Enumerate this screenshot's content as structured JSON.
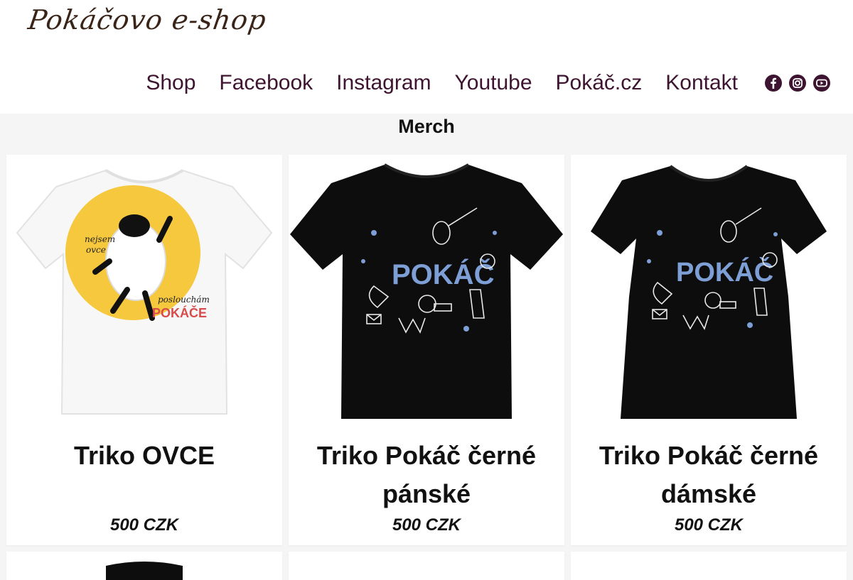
{
  "header": {
    "logo_text": "Pokáčovo e-shop",
    "nav": [
      {
        "label": "Shop"
      },
      {
        "label": "Facebook"
      },
      {
        "label": "Instagram"
      },
      {
        "label": "Youtube"
      },
      {
        "label": "Pokáč.cz"
      },
      {
        "label": "Kontakt"
      }
    ],
    "social_icons": [
      "facebook-icon",
      "instagram-icon",
      "youtube-icon"
    ],
    "nav_color": "#3d1530"
  },
  "section": {
    "title": "Merch"
  },
  "products": [
    {
      "name": "Triko OVCE",
      "price": "500 CZK",
      "image": "white t-shirt with sheep print",
      "shirt_color": "#ffffff"
    },
    {
      "name": "Triko Pokáč černé pánské",
      "price": "500 CZK",
      "image": "black men's t-shirt with Pokáč print",
      "shirt_color": "#111111"
    },
    {
      "name": "Triko Pokáč černé dámské",
      "price": "500 CZK",
      "image": "black women's t-shirt with Pokáč print",
      "shirt_color": "#111111"
    }
  ],
  "print": {
    "ovce_lines": [
      "nejsem",
      "ovce",
      "poslouchám",
      "POKÁČE"
    ],
    "pokac_text": "POKÁČ"
  }
}
